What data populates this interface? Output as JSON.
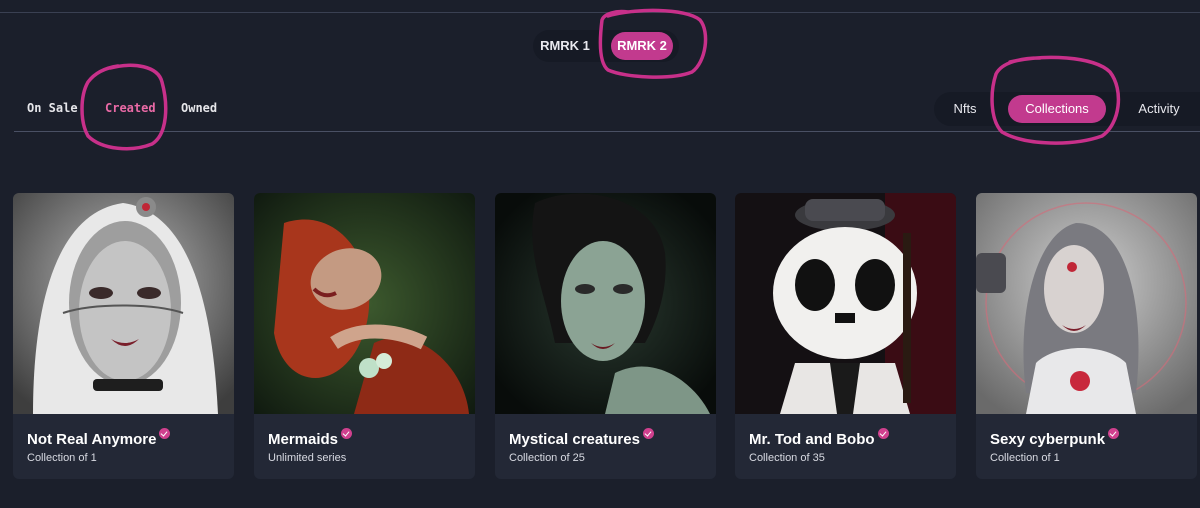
{
  "version_toggle": {
    "options": [
      "RMRK 1",
      "RMRK 2"
    ],
    "selected": "RMRK 2"
  },
  "profile_tabs": {
    "on_sale": "On Sale",
    "created": "Created",
    "owned": "Owned",
    "selected": "Created"
  },
  "view_switch": {
    "nfts": "Nfts",
    "collections": "Collections",
    "activity": "Activity",
    "selected": "Collections"
  },
  "collections": [
    {
      "title": "Not Real Anymore",
      "subtitle": "Collection of 1",
      "verified": true
    },
    {
      "title": "Mermaids",
      "subtitle": "Unlimited series",
      "verified": true
    },
    {
      "title": "Mystical creatures",
      "subtitle": "Collection of 25",
      "verified": true
    },
    {
      "title": "Mr. Tod and Bobo",
      "subtitle": "Collection of 35",
      "verified": true
    },
    {
      "title": "Sexy cyberpunk",
      "subtitle": "Collection of 1",
      "verified": true
    }
  ],
  "colors": {
    "background": "#1b1f2b",
    "card": "#232836",
    "accent": "#c23a8e",
    "annotation": "#c8308a"
  }
}
